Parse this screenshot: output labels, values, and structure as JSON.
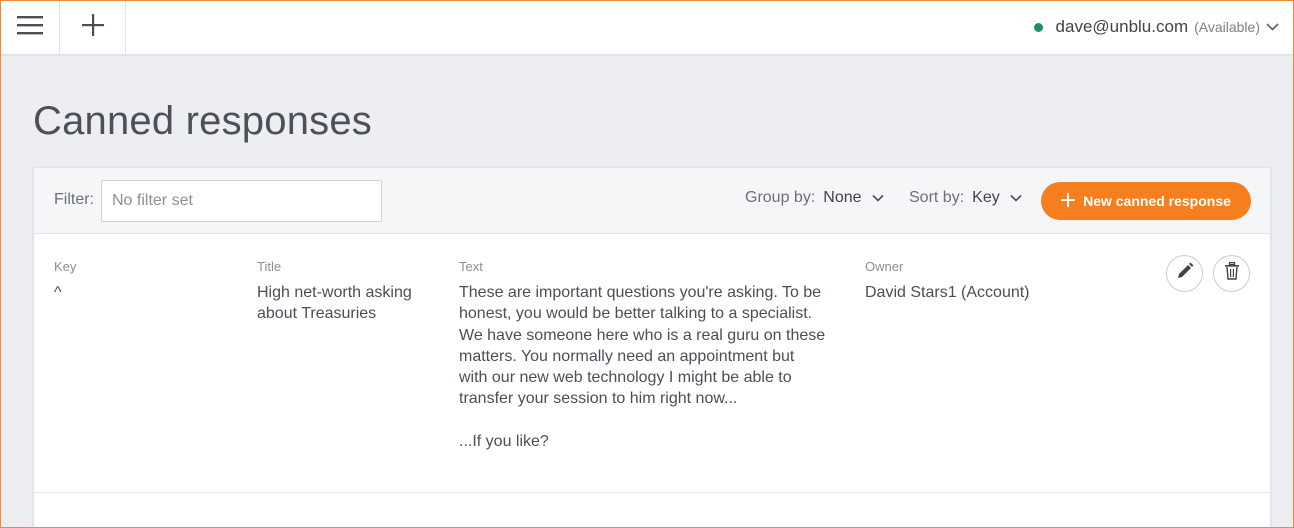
{
  "topbar": {
    "menu_icon": "hamburger-menu-icon",
    "add_icon": "plus-icon",
    "user": {
      "email": "dave@unblu.com",
      "status": "(Available)",
      "status_color": "#1a8f6a"
    }
  },
  "page": {
    "title": "Canned responses"
  },
  "toolbar": {
    "filter_label": "Filter:",
    "filter_placeholder": "No filter set",
    "filter_value": "",
    "group_by_label": "Group by:",
    "group_by_value": "None",
    "sort_by_label": "Sort by:",
    "sort_by_value": "Key",
    "new_button_label": "New canned response",
    "accent_color": "#f57f1f"
  },
  "table": {
    "headers": {
      "key": "Key",
      "title": "Title",
      "text": "Text",
      "owner": "Owner"
    },
    "rows": [
      {
        "key": "^",
        "title": "High net-worth asking\nabout Treasuries",
        "text": "These are important questions you're asking. To be\nhonest, you would be better talking to a specialist.\nWe have someone here who is a real guru on these\nmatters. You normally need an appointment but\nwith our new web technology I might be able to\ntransfer your session to him right now...\n\n...If you like?",
        "owner": "David Stars1 (Account)"
      }
    ]
  }
}
